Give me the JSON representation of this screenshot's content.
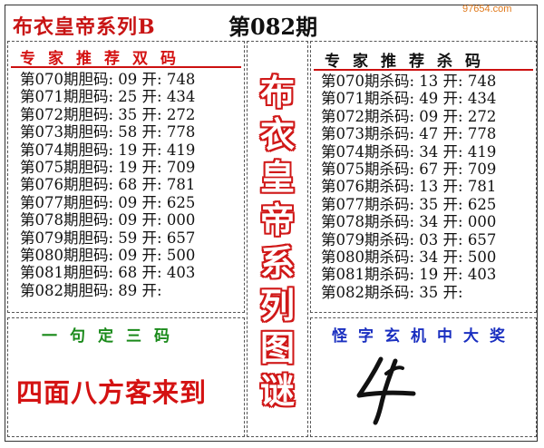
{
  "header": {
    "title": "布衣皇帝系列B",
    "issue": "第082期",
    "watermark": "97654.com"
  },
  "left_panel": {
    "title": "专家推荐双码",
    "rows": [
      "第070期胆码: 09 开: 748",
      "第071期胆码: 25 开: 434",
      "第072期胆码: 35 开: 272",
      "第073期胆码: 58 开: 778",
      "第074期胆码: 19 开: 419",
      "第075期胆码: 19 开: 709",
      "第076期胆码: 68 开: 781",
      "第077期胆码: 09 开: 625",
      "第078期胆码: 09 开: 000",
      "第079期胆码: 59 开: 657",
      "第080期胆码: 09 开: 500",
      "第081期胆码: 68 开: 403",
      "第082期胆码: 89 开:"
    ]
  },
  "right_panel": {
    "title": "专家推荐杀码",
    "rows": [
      "第070期杀码: 13 开: 748",
      "第071期杀码: 49 开: 434",
      "第072期杀码: 09 开: 272",
      "第073期杀码: 47 开: 778",
      "第074期杀码: 34 开: 419",
      "第075期杀码: 67 开: 709",
      "第076期杀码: 13 开: 781",
      "第077期杀码: 35 开: 625",
      "第078期杀码: 34 开: 000",
      "第079期杀码: 03 开: 657",
      "第080期杀码: 34 开: 500",
      "第081期杀码: 19 开: 403",
      "第082期杀码: 35 开:"
    ]
  },
  "center_vertical": {
    "chars": [
      "布",
      "衣",
      "皇",
      "帝",
      "系",
      "列",
      "图",
      "谜"
    ]
  },
  "bottom_left": {
    "title": "一句定三码",
    "slogan": "四面八方客来到"
  },
  "bottom_right": {
    "title": "怪字玄机中大奖"
  },
  "colors": {
    "red": "#d41212",
    "blue": "#1a2fc0",
    "green": "#1a8a1a",
    "text": "#111111"
  }
}
